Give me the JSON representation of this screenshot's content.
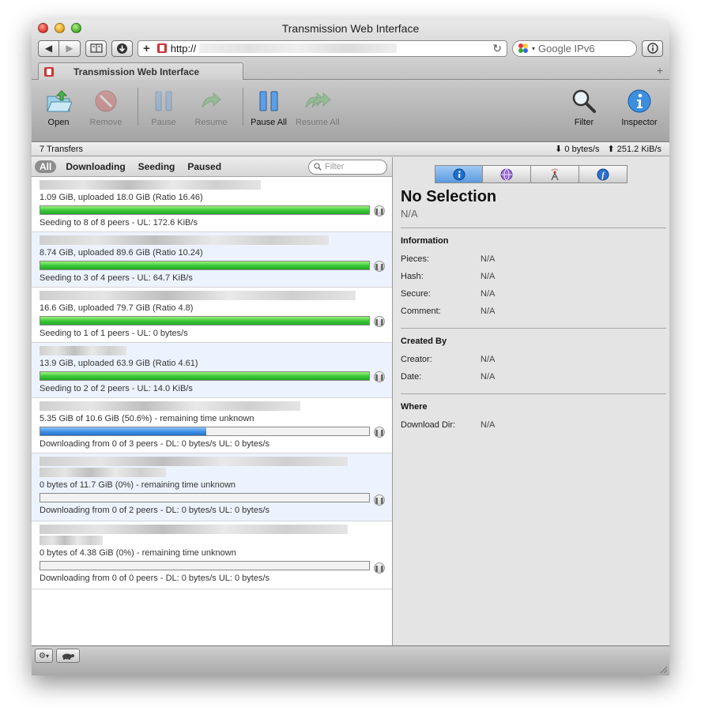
{
  "window": {
    "title": "Transmission Web Interface"
  },
  "browser": {
    "url_prefix": "http://",
    "search_placeholder": "Google IPv6",
    "tab_label": "Transmission Web Interface"
  },
  "toolbar": {
    "open": "Open",
    "remove": "Remove",
    "pause": "Pause",
    "resume": "Resume",
    "pause_all": "Pause All",
    "resume_all": "Resume All",
    "filter": "Filter",
    "inspector": "Inspector"
  },
  "status": {
    "transfers": "7 Transfers",
    "download_speed": "0 bytes/s",
    "upload_speed": "251.2 KiB/s"
  },
  "filters": {
    "all": "All",
    "downloading": "Downloading",
    "seeding": "Seeding",
    "paused": "Paused",
    "search_placeholder": "Filter"
  },
  "torrents": [
    {
      "progress_text": "1.09 GiB, uploaded 18.0 GiB (Ratio 16.46)",
      "peers_text": "Seeding to 8 of 8 peers - UL: 172.6 KiB/s",
      "percent": 100
    },
    {
      "progress_text": "8.74 GiB, uploaded 89.6 GiB (Ratio 10.24)",
      "peers_text": "Seeding to 3 of 4 peers - UL: 64.7 KiB/s",
      "percent": 100
    },
    {
      "progress_text": "16.6 GiB, uploaded 79.7 GiB (Ratio 4.8)",
      "peers_text": "Seeding to 1 of 1 peers - UL: 0 bytes/s",
      "percent": 100
    },
    {
      "progress_text": "13.9 GiB, uploaded 63.9 GiB (Ratio 4.61)",
      "peers_text": "Seeding to 2 of 2 peers - UL: 14.0 KiB/s",
      "percent": 100
    },
    {
      "progress_text": "5.35 GiB of 10.6 GiB (50.6%) - remaining time unknown",
      "peers_text": "Downloading from 0 of 3 peers - DL: 0 bytes/s UL: 0 bytes/s",
      "percent": 50.6
    },
    {
      "progress_text": "0 bytes of 11.7 GiB (0%) - remaining time unknown",
      "peers_text": "Downloading from 0 of 2 peers - DL: 0 bytes/s UL: 0 bytes/s",
      "percent": 0
    },
    {
      "progress_text": "0 bytes of 4.38 GiB (0%) - remaining time unknown",
      "peers_text": "Downloading from 0 of 0 peers - DL: 0 bytes/s UL: 0 bytes/s",
      "percent": 0
    }
  ],
  "inspector": {
    "title": "No Selection",
    "subtitle": "N/A",
    "information": {
      "heading": "Information",
      "pieces_label": "Pieces:",
      "pieces_value": "N/A",
      "hash_label": "Hash:",
      "hash_value": "N/A",
      "secure_label": "Secure:",
      "secure_value": "N/A",
      "comment_label": "Comment:",
      "comment_value": "N/A"
    },
    "created_by": {
      "heading": "Created By",
      "creator_label": "Creator:",
      "creator_value": "N/A",
      "date_label": "Date:",
      "date_value": "N/A"
    },
    "where": {
      "heading": "Where",
      "dir_label": "Download Dir:",
      "dir_value": "N/A"
    }
  },
  "colors": {
    "seed_bar": "#38c638",
    "download_bar": "#3c8fe3",
    "selected_alt_row": "#edf3fe",
    "inspector_tab_active": "#5a9be0"
  }
}
